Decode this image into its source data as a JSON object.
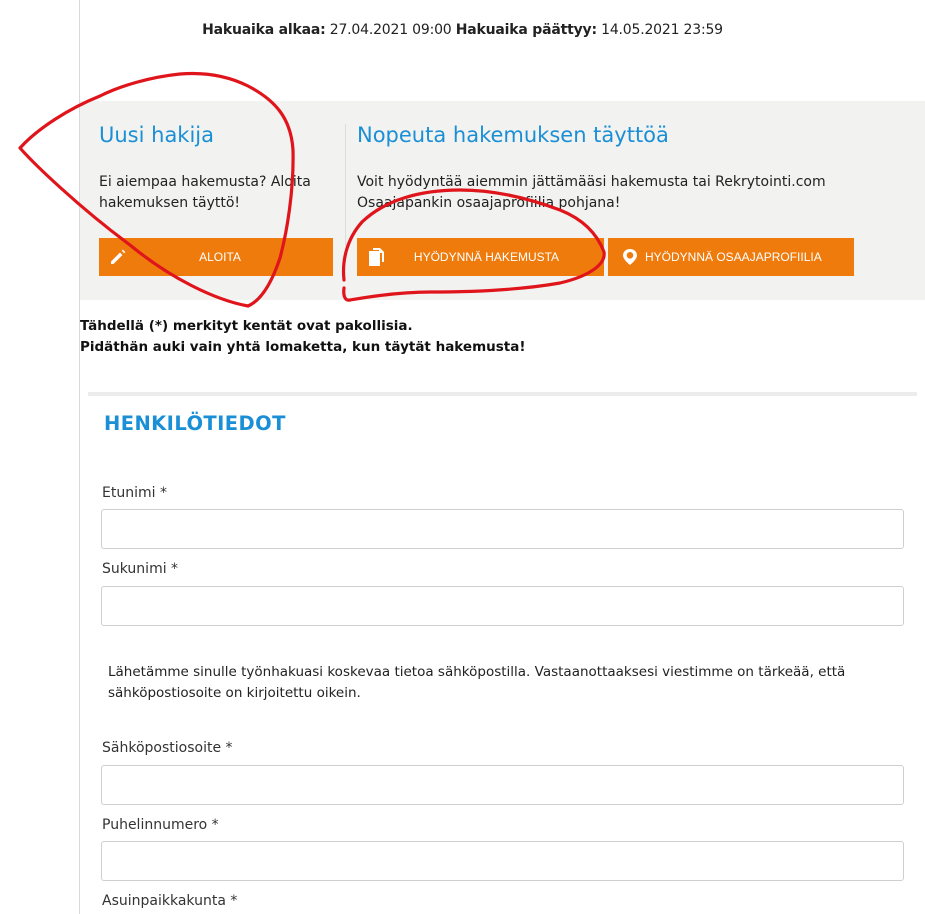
{
  "dates": {
    "start_label": "Hakuaika alkaa:",
    "start_value": "27.04.2021 09:00",
    "end_label": "Hakuaika päättyy:",
    "end_value": "14.05.2021 23:59"
  },
  "start_box": {
    "new_applicant": {
      "title": "Uusi hakija",
      "text": "Ei aiempaa hakemusta? Aloita hakemuksen täyttö!",
      "button_label": "ALOITA",
      "button_icon": "pencil-icon"
    },
    "speed_up": {
      "title": "Nopeuta hakemuksen täyttöä",
      "text": "Voit hyödyntää aiemmin jättämääsi hakemusta tai Rekrytointi.com Osaajapankin osaajaprofiilia pohjana!",
      "use_application_label": "HYÖDYNNÄ HAKEMUSTA",
      "use_application_icon": "copy-document-icon",
      "use_profile_label": "HYÖDYNNÄ OSAAJAPROFIILIA",
      "use_profile_icon": "location-pin-icon"
    }
  },
  "notes": {
    "required": "Tähdellä (*) merkityt kentät ovat pakollisia.",
    "one_form": "Pidäthän auki vain yhtä lomaketta, kun täytät hakemusta!"
  },
  "section": {
    "title": "HENKILÖTIEDOT"
  },
  "fields": {
    "first_name": {
      "label": "Etunimi *",
      "value": ""
    },
    "last_name": {
      "label": "Sukunimi *",
      "value": ""
    },
    "email_info": "Lähetämme sinulle työnhakuasi koskevaa tietoa sähköpostilla. Vastaanottaaksesi viestimme on tärkeää, että sähköpostiosoite on kirjoitettu oikein.",
    "email": {
      "label": "Sähköpostiosoite *",
      "value": ""
    },
    "phone": {
      "label": "Puhelinnumero *",
      "value": ""
    },
    "city": {
      "label": "Asuinpaikkakunta *"
    }
  },
  "colors": {
    "accent_blue": "#1a8fd6",
    "button_orange": "#ef7b0d",
    "annotation_red": "#e0151b",
    "panel_bg": "#f2f2f0"
  }
}
